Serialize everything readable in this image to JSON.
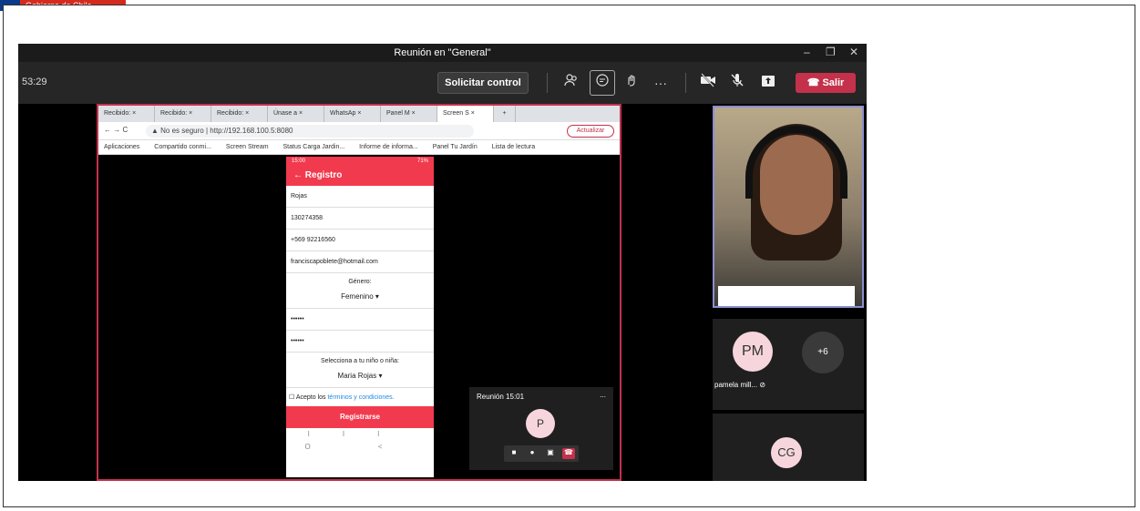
{
  "banner": {
    "text": "Gobierno de Chile"
  },
  "window": {
    "title": "Reunión en \"General\"",
    "minimize": "–",
    "maximize": "❐",
    "close": "✕"
  },
  "toolbar": {
    "timer": "53:29",
    "request_control": "Solicitar control",
    "participants_icon": "people-icon",
    "chat_icon": "chat-icon",
    "reactions_icon": "reactions-icon",
    "more": "···",
    "camera_icon": "camera-off-icon",
    "mic_icon": "mic-off-icon",
    "share_icon": "share-tray-icon",
    "leave": "Salir"
  },
  "browser": {
    "tabs": [
      {
        "label": "Recibido: ×"
      },
      {
        "label": "Recibido: ×"
      },
      {
        "label": "Recibido: ×"
      },
      {
        "label": "Únase a ×"
      },
      {
        "label": "WhatsAp ×"
      },
      {
        "label": "Panel M ×"
      },
      {
        "label": "Screen S ×"
      }
    ],
    "new_tab": "+",
    "nav": "← → C",
    "security": "No es seguro",
    "url": "http://192.168.100.5:8080",
    "update_button": "Actualizar",
    "bookmarks": [
      "Aplicaciones",
      "Compartido conmi...",
      "Screen Stream",
      "Status Carga Jardin...",
      "Informe de informa...",
      "Panel Tu Jardín",
      "Lista de lectura"
    ]
  },
  "phone": {
    "status": "15:00",
    "battery": "71%",
    "header": "Registro",
    "surname": "Rojas",
    "rut": "130274358",
    "phone_prefix": "+569",
    "phone_number": "92216560",
    "email": "franciscapoblete@hotmail.com",
    "gender_label": "Género:",
    "gender_value": "Femenino",
    "password": "••••••",
    "password_confirm": "••••••",
    "child_label": "Selecciona a tu niño o niña:",
    "child_value": "Maria Rojas",
    "terms_prefix": "Acepto los ",
    "terms_link": "términos y condiciones.",
    "register_button": "Registrarse",
    "android_nav": "III O <"
  },
  "mini_meeting": {
    "label": "Reunión",
    "time": "15:01",
    "more": "...",
    "avatar": "P"
  },
  "participants": {
    "pm_initials": "PM",
    "pm_name": "pamela mill...",
    "overflow": "+6",
    "cg_initials": "CG"
  }
}
